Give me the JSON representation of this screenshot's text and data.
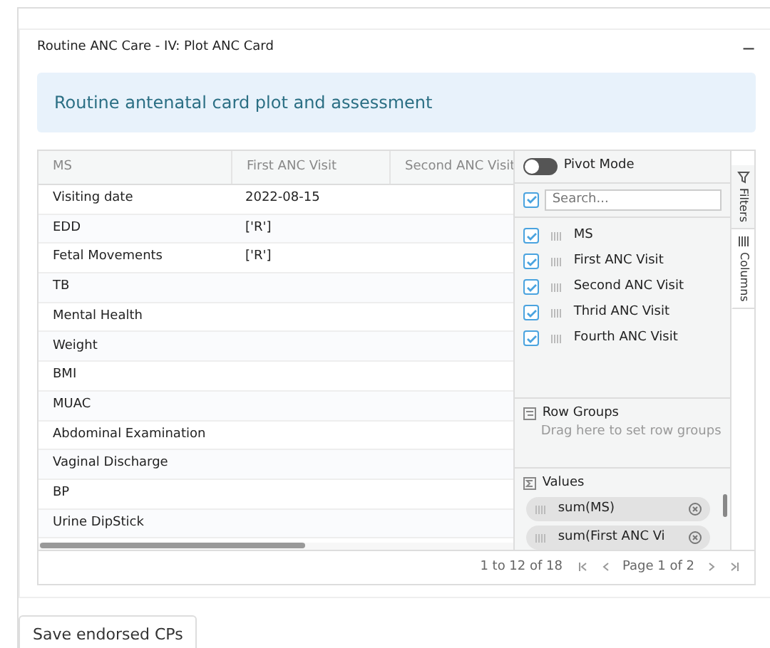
{
  "card": {
    "title": "Routine ANC Care - IV: Plot ANC Card",
    "collapse": "−"
  },
  "alert": "Routine antenatal card plot and assessment",
  "grid": {
    "columns": [
      "MS",
      "First ANC Visit",
      "Second ANC Visit"
    ],
    "rows": [
      [
        "Visiting date",
        "2022-08-15"
      ],
      [
        "EDD",
        "['R']"
      ],
      [
        "Fetal Movements",
        "['R']"
      ],
      [
        "TB"
      ],
      [
        "Mental Health"
      ],
      [
        "Weight"
      ],
      [
        "BMI"
      ],
      [
        "MUAC"
      ],
      [
        "Abdominal Examination"
      ],
      [
        "Vaginal Discharge"
      ],
      [
        "BP"
      ],
      [
        "Urine DipStick"
      ]
    ],
    "side_panel": {
      "pivot_mode": {
        "label": "Pivot Mode",
        "on": false
      },
      "search": {
        "placeholder": "Search...",
        "checked": true
      },
      "columns": [
        {
          "label": "MS",
          "checked": true
        },
        {
          "label": "First ANC Visit",
          "checked": true
        },
        {
          "label": "Second ANC Visit",
          "checked": true
        },
        {
          "label": "Thrid ANC Visit",
          "checked": true
        },
        {
          "label": "Fourth ANC Visit",
          "checked": true
        }
      ],
      "row_groups": {
        "title": "Row Groups",
        "hint": "Drag here to set row groups"
      },
      "values": {
        "title": "Values",
        "items": [
          "sum(MS)",
          "sum(First ANC Vi"
        ]
      }
    },
    "side_tabs": [
      {
        "label": "Filters",
        "selected": false
      },
      {
        "label": "Columns",
        "selected": true
      }
    ],
    "pagination": {
      "summary": "1 to 12 of 18",
      "page": "Page 1 of 2"
    }
  },
  "buttons": [
    "Save endorsed CPs"
  ]
}
